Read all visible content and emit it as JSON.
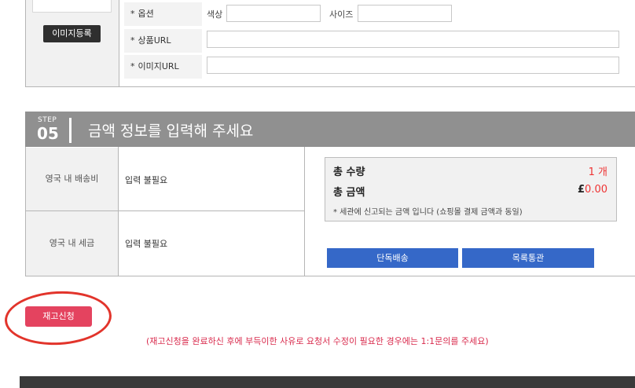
{
  "item": {
    "image_register_label": "이미지등록",
    "options_label": "옵션",
    "color_label": "색상",
    "color_value": "",
    "size_label": "사이즈",
    "size_value": "",
    "product_url_label": "상품URL",
    "product_url_value": "",
    "image_url_label": "이미지URL",
    "image_url_value": "",
    "required_mark": "*"
  },
  "step": {
    "word": "STEP",
    "number": "05",
    "title": "금액 정보를 입력해 주세요"
  },
  "price_table": {
    "rows": [
      {
        "label": "영국 내 배송비",
        "value": "입력 불필요"
      },
      {
        "label": "영국 내 세금",
        "value": "입력 불필요"
      }
    ]
  },
  "summary": {
    "total_qty_label": "총 수량",
    "total_qty_value": "1 개",
    "total_amount_label": "총 금액",
    "currency_symbol": "£",
    "total_amount_value": "0.00",
    "note": "* 세관에 신고되는 금액 입니다 (쇼핑몰 결제 금액과 동일)"
  },
  "buttons": {
    "single_shipping": "단독배송",
    "list_clearance": "목록통관",
    "restock_request": "재고신청"
  },
  "notice": "(재고신청을 완료하신 후에 부득이한 사유로 요청서 수정이 필요한 경우에는 1:1문의를 주세요)",
  "colors": {
    "accent_blue": "#3568c8",
    "request_pink": "#e4435f",
    "highlight_red": "#e2342b",
    "step_gray": "#909090"
  }
}
